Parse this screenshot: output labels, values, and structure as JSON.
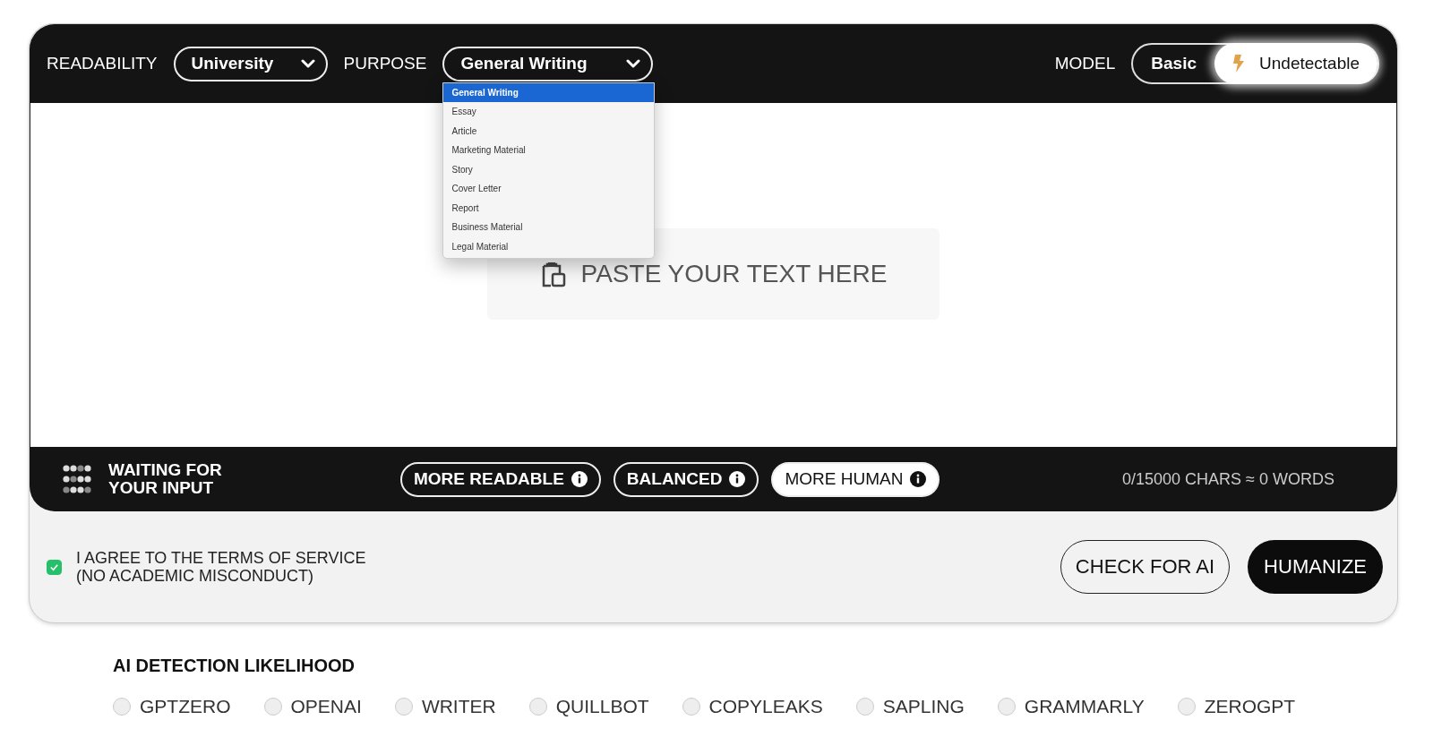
{
  "readability": {
    "label": "READABILITY",
    "value": "University"
  },
  "purpose": {
    "label": "PURPOSE",
    "value": "General Writing",
    "expanded": true,
    "options": [
      {
        "label": "General Writing",
        "selected": true
      },
      {
        "label": "Essay",
        "selected": false
      },
      {
        "label": "Article",
        "selected": false
      },
      {
        "label": "Marketing Material",
        "selected": false
      },
      {
        "label": "Story",
        "selected": false
      },
      {
        "label": "Cover Letter",
        "selected": false
      },
      {
        "label": "Report",
        "selected": false
      },
      {
        "label": "Business Material",
        "selected": false
      },
      {
        "label": "Legal Material",
        "selected": false
      }
    ]
  },
  "model": {
    "label": "MODEL",
    "options": [
      {
        "label": "Basic",
        "selected": false
      },
      {
        "label": "Undetectable",
        "selected": true
      }
    ]
  },
  "editor": {
    "paste_label": "PASTE YOUR TEXT HERE"
  },
  "status": {
    "text": "WAITING FOR\nYOUR INPUT"
  },
  "modes": [
    {
      "label": "MORE READABLE",
      "selected": false
    },
    {
      "label": "BALANCED",
      "selected": false
    },
    {
      "label": "MORE HUMAN",
      "selected": true
    }
  ],
  "counter": "0/15000 CHARS ≈ 0 WORDS",
  "agreement": {
    "text": "I AGREE TO THE TERMS OF SERVICE\n(NO ACADEMIC MISCONDUCT)",
    "checked": true
  },
  "buttons": {
    "check": "CHECK FOR AI",
    "humanize": "HUMANIZE"
  },
  "detection": {
    "title": "AI DETECTION LIKELIHOOD",
    "detectors": [
      {
        "label": "GPTZERO",
        "selected": false
      },
      {
        "label": "OPENAI",
        "selected": false
      },
      {
        "label": "WRITER",
        "selected": false
      },
      {
        "label": "QUILLBOT",
        "selected": false
      },
      {
        "label": "COPYLEAKS",
        "selected": false
      },
      {
        "label": "SAPLING",
        "selected": false
      },
      {
        "label": "GRAMMARLY",
        "selected": false
      },
      {
        "label": "ZEROGPT",
        "selected": false
      }
    ]
  }
}
